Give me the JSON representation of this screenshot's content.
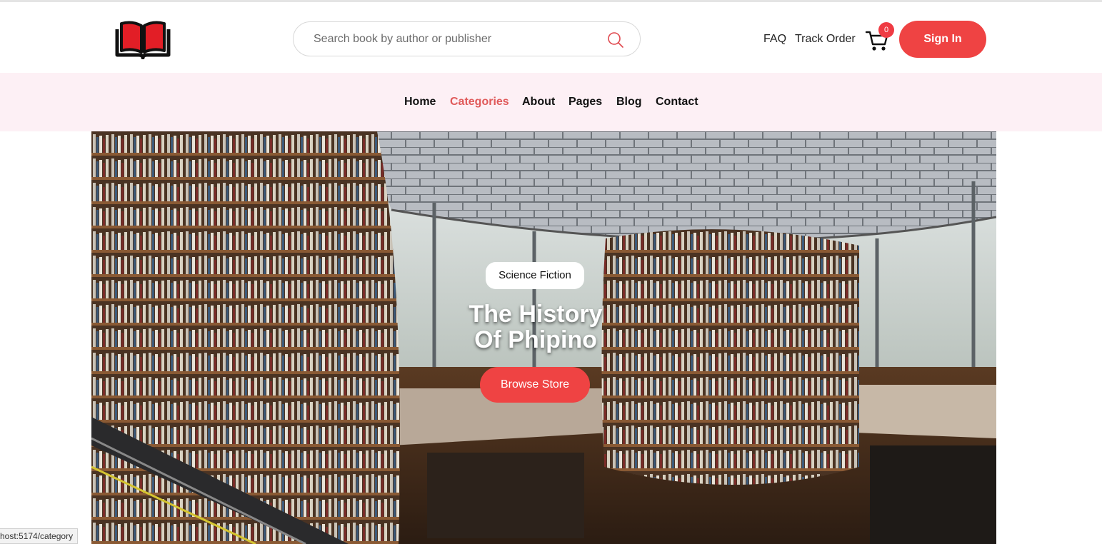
{
  "search": {
    "placeholder": "Search book by author or publisher"
  },
  "header": {
    "links": [
      "FAQ",
      "Track Order"
    ],
    "cart_count": "0",
    "signin_label": "Sign In"
  },
  "nav": {
    "items": [
      "Home",
      "Categories",
      "About",
      "Pages",
      "Blog",
      "Contact"
    ],
    "active": "Categories"
  },
  "hero": {
    "badge": "Science Fiction",
    "title_line1": "The History",
    "title_line2": "Of Phipino",
    "button": "Browse Store"
  },
  "status_bar": {
    "url": "host:5174/category"
  },
  "colors": {
    "accent": "#ef4343",
    "nav_bg": "#fdf0f5",
    "active_nav": "#e05a5a"
  },
  "icons": [
    "book-logo-icon",
    "search-icon",
    "cart-icon"
  ]
}
